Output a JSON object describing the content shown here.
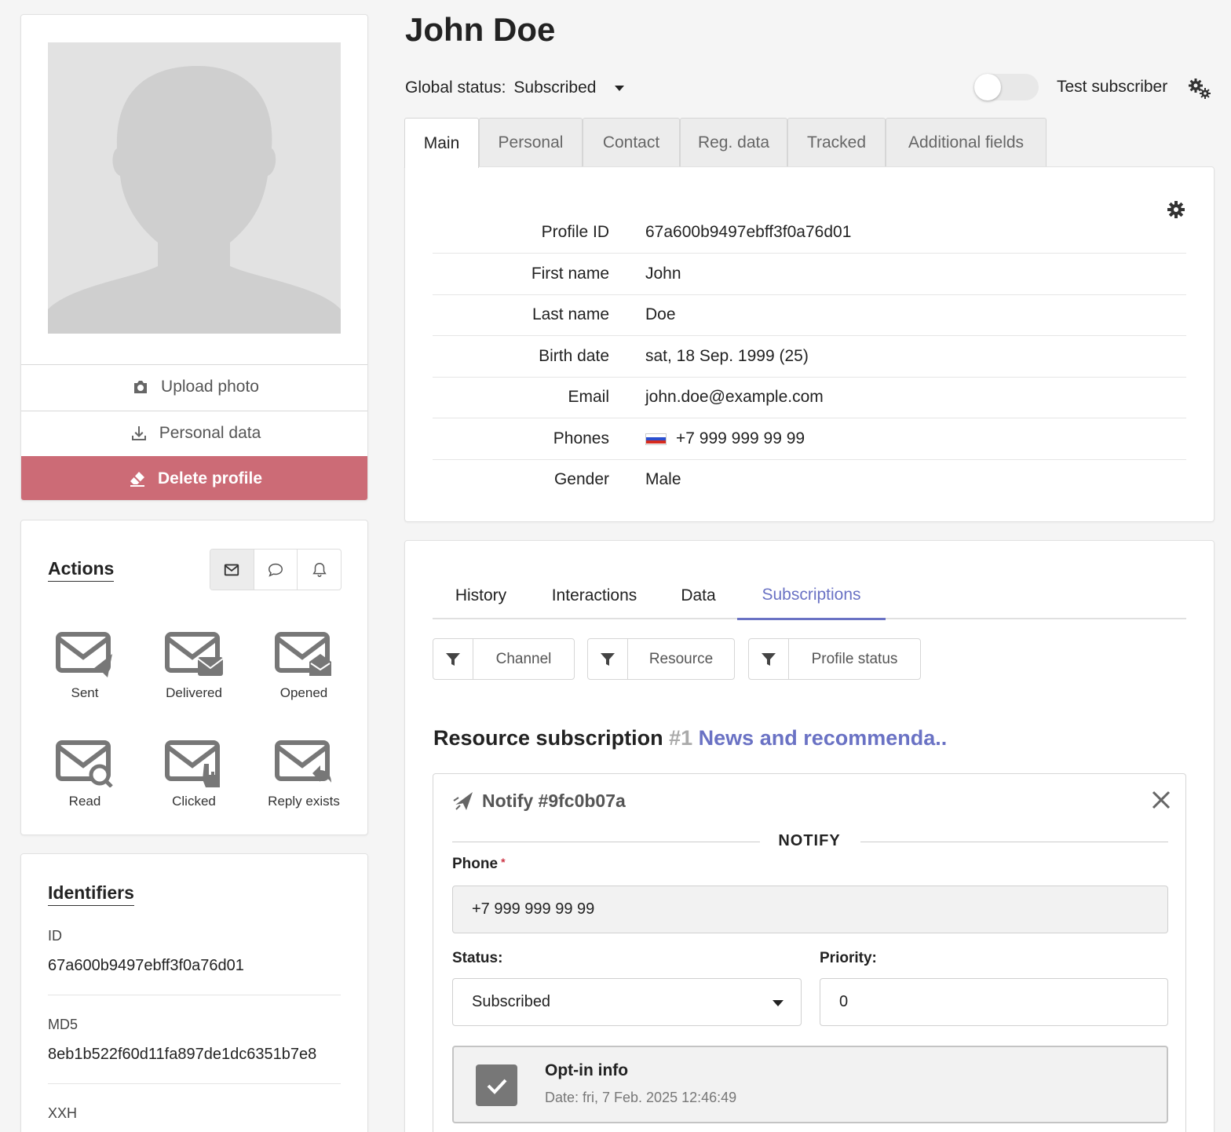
{
  "profile": {
    "name": "John Doe",
    "upload_photo": "Upload photo",
    "personal_data": "Personal data",
    "delete_profile": "Delete profile"
  },
  "actions": {
    "title": "Actions",
    "channel_icons": [
      "envelope-icon",
      "chat-bubble-icon",
      "bell-icon"
    ],
    "items": [
      "Sent",
      "Delivered",
      "Opened",
      "Read",
      "Clicked",
      "Reply exists"
    ]
  },
  "identifiers": {
    "title": "Identifiers",
    "id_label": "ID",
    "id_value": "67a600b9497ebff3f0a76d01",
    "md5_label": "MD5",
    "md5_value": "8eb1b522f60d11fa897de1dc6351b7e8",
    "xxh_label": "XXH"
  },
  "header": {
    "global_status_label": "Global status:",
    "global_status_value": "Subscribed",
    "test_subscriber": "Test subscriber",
    "test_subscriber_enabled": false
  },
  "tabs": [
    "Main",
    "Personal",
    "Contact",
    "Reg. data",
    "Tracked",
    "Additional fields"
  ],
  "active_tab": "Main",
  "main": {
    "rows": [
      {
        "key": "Profile ID",
        "value": "67a600b9497ebff3f0a76d01"
      },
      {
        "key": "First name",
        "value": "John"
      },
      {
        "key": "Last name",
        "value": "Doe"
      },
      {
        "key": "Birth date",
        "value": "sat, 18 Sep. 1999 (25)"
      },
      {
        "key": "Email",
        "value": "john.doe@example.com"
      },
      {
        "key": "Phones",
        "value": "+7 999 999 99 99"
      },
      {
        "key": "Gender",
        "value": "Male"
      }
    ]
  },
  "sub_tabs": [
    "History",
    "Interactions",
    "Data",
    "Subscriptions"
  ],
  "active_sub_tab": "Subscriptions",
  "filters": [
    "Channel",
    "Resource",
    "Profile status"
  ],
  "subscription": {
    "title": "Resource subscription",
    "number": "#1",
    "resource_name": "News and recommenda..",
    "notify_title": "Notify #9fc0b07a",
    "section_label": "NOTIFY",
    "phone_label": "Phone",
    "phone_required": "*",
    "phone_value": "+7 999 999 99 99",
    "status_label": "Status:",
    "status_value": "Subscribed",
    "priority_label": "Priority:",
    "priority_value": "0",
    "optin_title": "Opt-in info",
    "optin_date": "Date: fri, 7 Feb. 2025 12:46:49",
    "optin_checked": true
  },
  "colors": {
    "accent": "#6a72c4",
    "danger": "#cc6b76"
  }
}
